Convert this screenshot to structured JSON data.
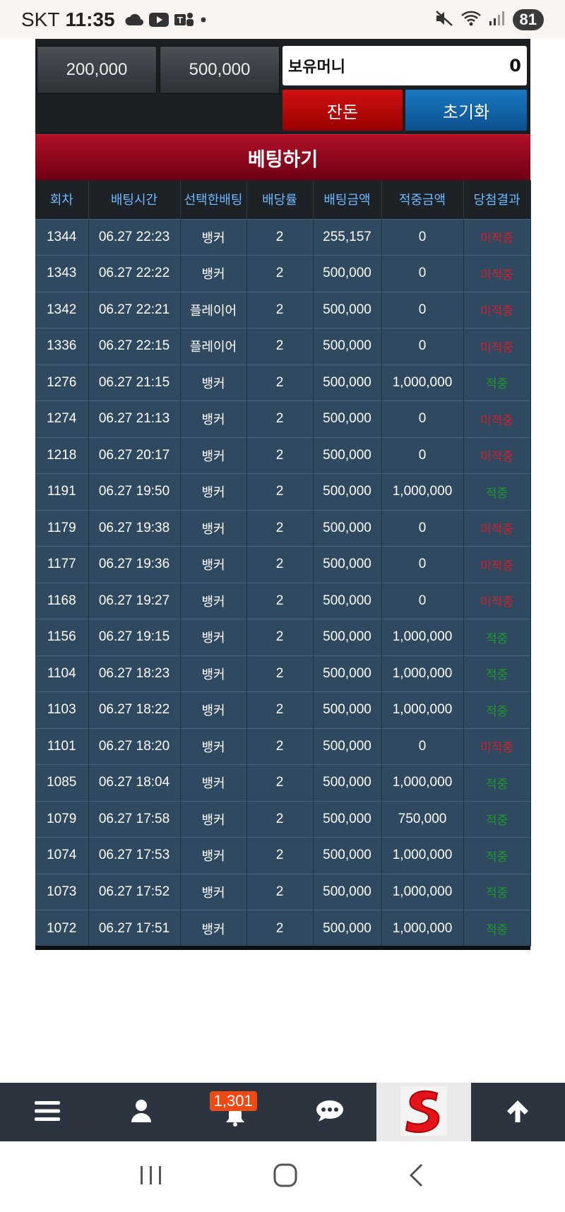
{
  "status_bar": {
    "carrier": "SKT",
    "time": "11:35",
    "battery": "81"
  },
  "controls": {
    "amount_buttons": [
      "200,000",
      "500,000"
    ],
    "money_label": "보유머니",
    "money_value": "0",
    "change_label": "잔돈",
    "reset_label": "초기화",
    "bet_label": "베팅하기"
  },
  "table": {
    "headers": [
      "회차",
      "배팅시간",
      "선택한배팅",
      "배당률",
      "배팅금액",
      "적중금액",
      "당첨결과"
    ],
    "rows": [
      {
        "round": "1344",
        "time": "06.27 22:23",
        "pick": "뱅커",
        "odds": "2",
        "amount": "255,157",
        "win": "0",
        "result": "미적중",
        "status": "lose"
      },
      {
        "round": "1343",
        "time": "06.27 22:22",
        "pick": "뱅커",
        "odds": "2",
        "amount": "500,000",
        "win": "0",
        "result": "미적중",
        "status": "lose"
      },
      {
        "round": "1342",
        "time": "06.27 22:21",
        "pick": "플레이어",
        "odds": "2",
        "amount": "500,000",
        "win": "0",
        "result": "미적중",
        "status": "lose"
      },
      {
        "round": "1336",
        "time": "06.27 22:15",
        "pick": "플레이어",
        "odds": "2",
        "amount": "500,000",
        "win": "0",
        "result": "미적중",
        "status": "lose"
      },
      {
        "round": "1276",
        "time": "06.27 21:15",
        "pick": "뱅커",
        "odds": "2",
        "amount": "500,000",
        "win": "1,000,000",
        "result": "적중",
        "status": "win"
      },
      {
        "round": "1274",
        "time": "06.27 21:13",
        "pick": "뱅커",
        "odds": "2",
        "amount": "500,000",
        "win": "0",
        "result": "미적중",
        "status": "lose"
      },
      {
        "round": "1218",
        "time": "06.27 20:17",
        "pick": "뱅커",
        "odds": "2",
        "amount": "500,000",
        "win": "0",
        "result": "미적중",
        "status": "lose"
      },
      {
        "round": "1191",
        "time": "06.27 19:50",
        "pick": "뱅커",
        "odds": "2",
        "amount": "500,000",
        "win": "1,000,000",
        "result": "적중",
        "status": "win"
      },
      {
        "round": "1179",
        "time": "06.27 19:38",
        "pick": "뱅커",
        "odds": "2",
        "amount": "500,000",
        "win": "0",
        "result": "미적중",
        "status": "lose"
      },
      {
        "round": "1177",
        "time": "06.27 19:36",
        "pick": "뱅커",
        "odds": "2",
        "amount": "500,000",
        "win": "0",
        "result": "미적중",
        "status": "lose"
      },
      {
        "round": "1168",
        "time": "06.27 19:27",
        "pick": "뱅커",
        "odds": "2",
        "amount": "500,000",
        "win": "0",
        "result": "미적중",
        "status": "lose"
      },
      {
        "round": "1156",
        "time": "06.27 19:15",
        "pick": "뱅커",
        "odds": "2",
        "amount": "500,000",
        "win": "1,000,000",
        "result": "적중",
        "status": "win"
      },
      {
        "round": "1104",
        "time": "06.27 18:23",
        "pick": "뱅커",
        "odds": "2",
        "amount": "500,000",
        "win": "1,000,000",
        "result": "적중",
        "status": "win"
      },
      {
        "round": "1103",
        "time": "06.27 18:22",
        "pick": "뱅커",
        "odds": "2",
        "amount": "500,000",
        "win": "1,000,000",
        "result": "적중",
        "status": "win"
      },
      {
        "round": "1101",
        "time": "06.27 18:20",
        "pick": "뱅커",
        "odds": "2",
        "amount": "500,000",
        "win": "0",
        "result": "미적중",
        "status": "lose"
      },
      {
        "round": "1085",
        "time": "06.27 18:04",
        "pick": "뱅커",
        "odds": "2",
        "amount": "500,000",
        "win": "1,000,000",
        "result": "적중",
        "status": "win"
      },
      {
        "round": "1079",
        "time": "06.27 17:58",
        "pick": "뱅커",
        "odds": "2",
        "amount": "500,000",
        "win": "750,000",
        "result": "적중",
        "status": "win"
      },
      {
        "round": "1074",
        "time": "06.27 17:53",
        "pick": "뱅커",
        "odds": "2",
        "amount": "500,000",
        "win": "1,000,000",
        "result": "적중",
        "status": "win"
      },
      {
        "round": "1073",
        "time": "06.27 17:52",
        "pick": "뱅커",
        "odds": "2",
        "amount": "500,000",
        "win": "1,000,000",
        "result": "적중",
        "status": "win"
      },
      {
        "round": "1072",
        "time": "06.27 17:51",
        "pick": "뱅커",
        "odds": "2",
        "amount": "500,000",
        "win": "1,000,000",
        "result": "적중",
        "status": "win"
      }
    ]
  },
  "bottom_nav": {
    "notification_count": "1,301",
    "icons": [
      "menu-icon",
      "user-icon",
      "bell-icon",
      "chat-icon",
      "site-logo",
      "arrow-up-icon"
    ]
  },
  "colors": {
    "lose": "#d0202c",
    "win": "#1c9a2c",
    "header_text": "#6fb8ff",
    "row_bg": "#2f4a60"
  }
}
